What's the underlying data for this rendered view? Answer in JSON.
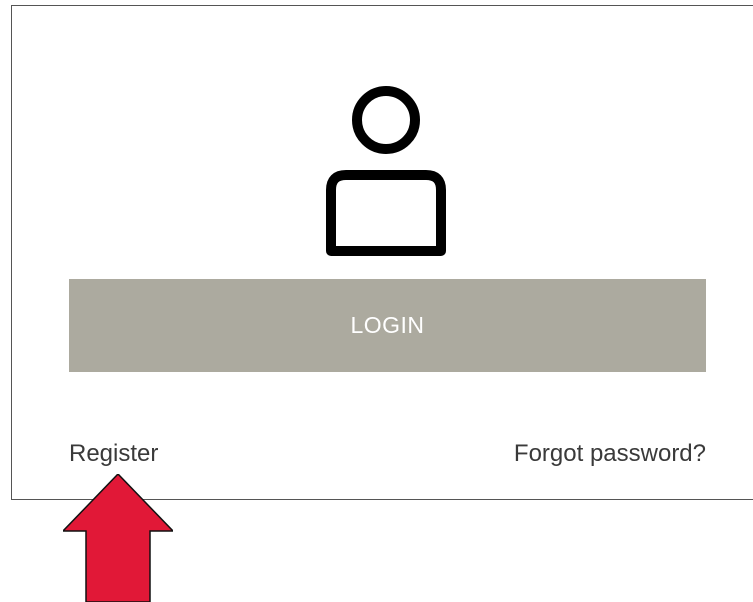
{
  "login": {
    "button_label": "LOGIN",
    "button_color": "#acaa9f"
  },
  "links": {
    "register_label": "Register",
    "forgot_label": "Forgot password?"
  },
  "icons": {
    "user": "user-icon",
    "arrow": "up-arrow-icon"
  },
  "colors": {
    "arrow": "#e11837",
    "panel_border": "#555555",
    "link_text": "#3a3a3a"
  }
}
